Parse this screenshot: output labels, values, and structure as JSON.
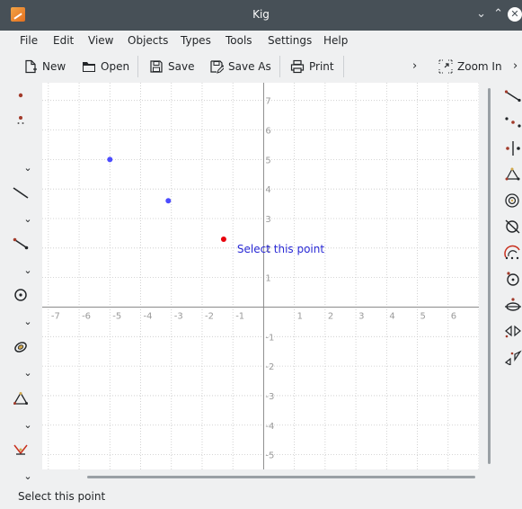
{
  "window": {
    "title": "Kig",
    "min_glyph": "⌄",
    "max_glyph": "⌃",
    "close_glyph": "✕"
  },
  "menu": [
    "File",
    "Edit",
    "View",
    "Objects",
    "Types",
    "Tools",
    "Settings",
    "Help"
  ],
  "toolbar": {
    "new_label": "New",
    "open_label": "Open",
    "save_label": "Save",
    "save_as_label": "Save As",
    "print_label": "Print",
    "zoom_in_label": "Zoom In",
    "overflow_glyph": "›"
  },
  "left_tools": [
    "point-tool-icon",
    "constrained-point-icon",
    "line-tool-icon",
    "segment-tool-icon",
    "circle-tool-icon",
    "conic-tool-icon",
    "triangle-tool-icon",
    "transform-tool-icon"
  ],
  "left_chevron_glyph": "⌄",
  "canvas": {
    "x_ticks": [
      "-7",
      "-6",
      "-5",
      "-4",
      "-3",
      "-2",
      "-1",
      "1",
      "2",
      "3",
      "4",
      "5",
      "6"
    ],
    "y_ticks": [
      "7",
      "6",
      "5",
      "4",
      "3",
      "2",
      "1",
      "-1",
      "-2",
      "-3",
      "-4",
      "-5"
    ],
    "x_range": [
      -7.2,
      7.0
    ],
    "y_range": [
      -5.5,
      7.6
    ],
    "points": [
      {
        "x": -5.0,
        "y": 5.0,
        "color": "#4c4cff"
      },
      {
        "x": -3.1,
        "y": 3.6,
        "color": "#4c4cff"
      },
      {
        "x": -1.3,
        "y": 2.3,
        "color": "#e8000b"
      }
    ],
    "hover_label": "Select this point",
    "hover_color": "#2a2ad6",
    "grid_color": "#c8c8c8",
    "axis_color": "#8a8a8a"
  },
  "right_tools": [
    "vector-icon",
    "midpoint-icon",
    "mirror-point-icon",
    "triangle-points-icon",
    "spiral-icon",
    "intersection-icon",
    "arc-icon",
    "circle-by-center-icon",
    "line-through-circle-icon",
    "translation-icon",
    "rotation-icon"
  ],
  "status": {
    "text": "Select this point"
  }
}
